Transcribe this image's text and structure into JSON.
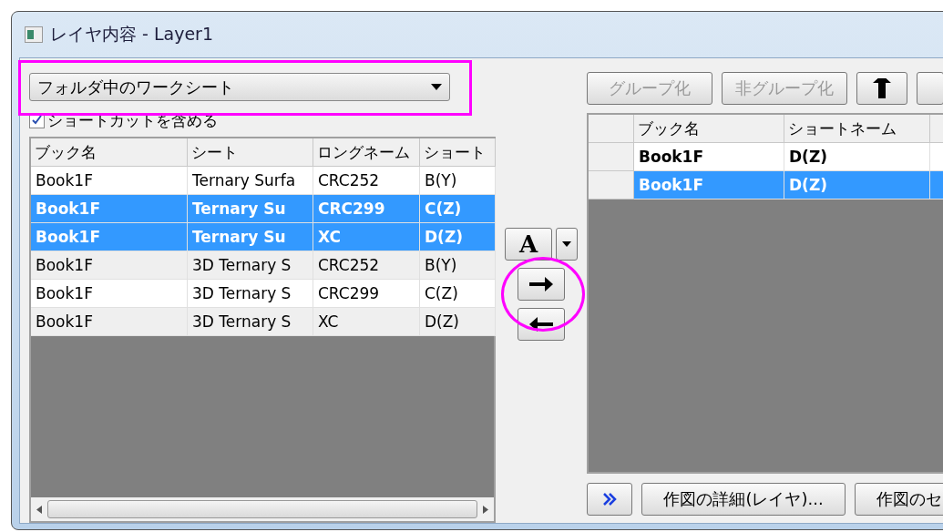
{
  "window": {
    "title": "レイヤ内容 - Layer1"
  },
  "source": {
    "value": "フォルダ中のワークシート"
  },
  "include_shortcuts": {
    "label": "ショートカットを含める",
    "checked": true
  },
  "left_table": {
    "columns": [
      "ブック名",
      "シート",
      "ロングネーム",
      "ショート"
    ],
    "rows": [
      {
        "cells": [
          "Book1F",
          "Ternary Surfa",
          "CRC252",
          "B(Y)"
        ],
        "selected": false
      },
      {
        "cells": [
          "Book1F",
          "Ternary Su",
          "CRC299",
          "C(Z)"
        ],
        "selected": true
      },
      {
        "cells": [
          "Book1F",
          "Ternary Su",
          "XC",
          "D(Z)"
        ],
        "selected": true
      },
      {
        "cells": [
          "Book1F",
          "3D Ternary S",
          "CRC252",
          "B(Y)"
        ],
        "selected": false
      },
      {
        "cells": [
          "Book1F",
          "3D Ternary S",
          "CRC299",
          "C(Z)"
        ],
        "selected": false
      },
      {
        "cells": [
          "Book1F",
          "3D Ternary S",
          "XC",
          "D(Z)"
        ],
        "selected": false
      }
    ]
  },
  "middle": {
    "font_button": "A"
  },
  "right_toolbar": [
    {
      "label": "グループ化",
      "disabled": true
    },
    {
      "label": "非グループ化",
      "disabled": true
    }
  ],
  "right_table": {
    "columns": [
      "ブック名",
      "ショートネーム"
    ],
    "rows": [
      {
        "cells": [
          "Book1F",
          "D(Z)"
        ],
        "selected": false
      },
      {
        "cells": [
          "Book1F",
          "D(Z)"
        ],
        "selected": true
      }
    ]
  },
  "bottom_buttons": [
    "作図の詳細(レイヤ)...",
    "作図のセ"
  ]
}
